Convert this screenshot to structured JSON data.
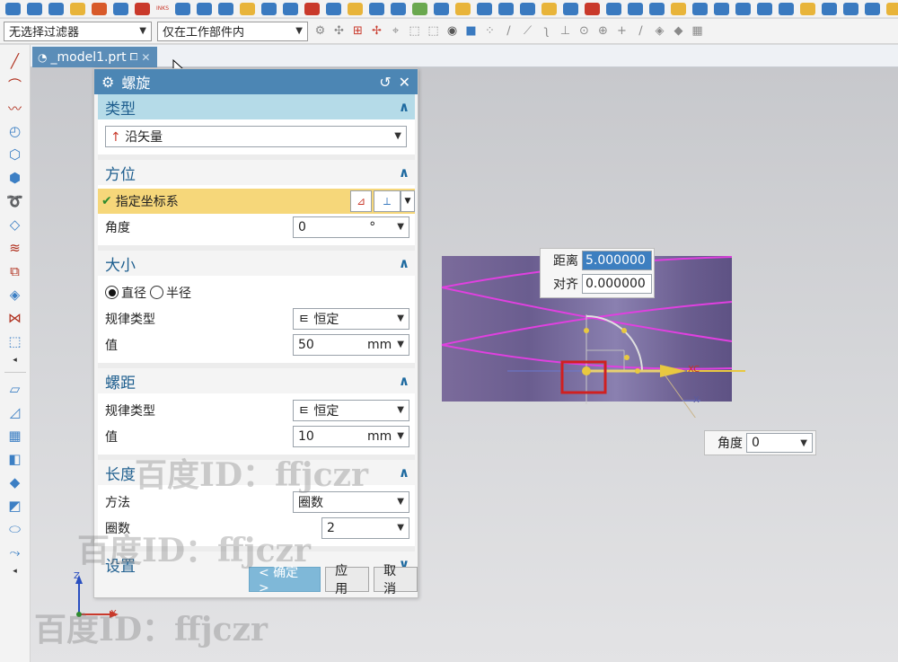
{
  "toolbar": {
    "filter_value": "无选择过滤器",
    "scope_value": "仅在工作部件内",
    "icon_colors": [
      "#3a7ac0",
      "#3a7ac0",
      "#3a7ac0",
      "#e8b43a",
      "#d85a2a",
      "#3a7ac0",
      "#c9392b",
      "#3a7ac0",
      "#3a7ac0",
      "#3a7ac0",
      "#e8b43a",
      "#3a7ac0",
      "#3a7ac0",
      "#c9392b",
      "#3a7ac0",
      "#e8b43a",
      "#3a7ac0",
      "#3a7ac0",
      "#6aa84f",
      "#3a7ac0",
      "#e8b43a",
      "#3a7ac0",
      "#3a7ac0",
      "#3a7ac0",
      "#e8b43a",
      "#3a7ac0",
      "#c9392b",
      "#3a7ac0",
      "#3a7ac0",
      "#3a7ac0",
      "#e8b43a",
      "#3a7ac0",
      "#3a7ac0",
      "#3a7ac0",
      "#3a7ac0",
      "#3a7ac0",
      "#e8b43a",
      "#3a7ac0",
      "#3a7ac0",
      "#3a7ac0",
      "#e8b43a",
      "#3a7ac0"
    ],
    "inks_label": "INKS"
  },
  "tab": {
    "label": "_model1.prt"
  },
  "dialog": {
    "title": "螺旋",
    "type_section": {
      "title": "类型",
      "value": "沿矢量"
    },
    "orientation_section": {
      "title": "方位",
      "specify_csys": "指定坐标系",
      "angle_label": "角度",
      "angle_value": "0",
      "angle_unit": "°"
    },
    "size_section": {
      "title": "大小",
      "diameter_label": "直径",
      "radius_label": "半径",
      "law_label": "规律类型",
      "law_value": "恒定",
      "value_label": "值",
      "value": "50",
      "unit": "mm"
    },
    "pitch_section": {
      "title": "螺距",
      "law_label": "规律类型",
      "law_value": "恒定",
      "value_label": "值",
      "value": "10",
      "unit": "mm"
    },
    "length_section": {
      "title": "长度",
      "method_label": "方法",
      "method_value": "圈数",
      "turns_label": "圈数",
      "turns_value": "2"
    },
    "settings_section": {
      "title": "设置"
    },
    "buttons": {
      "ok": "< 确定 >",
      "apply": "应用",
      "cancel": "取消"
    }
  },
  "hud": {
    "distance_label": "距离",
    "distance_value": "5.000000",
    "align_label": "对齐",
    "align_value": "0.000000",
    "angle_label": "角度",
    "angle_value": "0"
  },
  "axis_labels": {
    "x": "X",
    "y": "Y",
    "z": "Z",
    "xc": "XC"
  },
  "watermark": "百度ID：ffjczr",
  "colors": {
    "accent": "#4c86b4",
    "highlight": "#f6d77a",
    "helix": "#e040e0",
    "selection": "#d02020"
  }
}
